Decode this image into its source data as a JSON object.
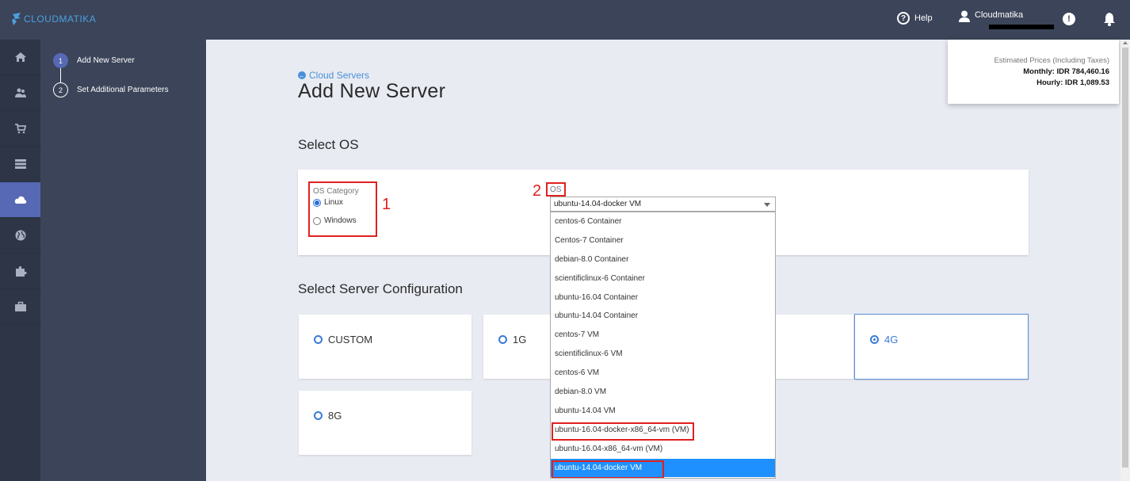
{
  "brand": {
    "logo_text": "CLOUDMATIKA",
    "accent": "#4da0df"
  },
  "topbar": {
    "help_label": "Help",
    "user_name": "Cloudmatika"
  },
  "iconbar": [
    "home-icon",
    "users-icon",
    "cart-icon",
    "server-list-icon",
    "cloud-icon",
    "globe-icon",
    "puzzle-icon",
    "briefcase-icon"
  ],
  "steps": [
    {
      "num": "1",
      "label": "Add New Server"
    },
    {
      "num": "2",
      "label": "Set Additional Parameters"
    }
  ],
  "main": {
    "back_label": "Cloud Servers",
    "title": "Add New Server",
    "select_os_heading": "Select OS",
    "config_heading": "Select Server Configuration"
  },
  "os_section": {
    "category_label": "OS Category",
    "linux_label": "Linux",
    "windows_label": "Windows",
    "os_label": "OS",
    "selected_os": "ubuntu-14.04-docker VM",
    "annotation_1": "1",
    "annotation_2": "2",
    "options": [
      "centos-6 Container",
      "Centos-7 Container",
      "debian-8.0 Container",
      "scientificlinux-6 Container",
      "ubuntu-16.04 Container",
      "ubuntu-14.04 Container",
      "centos-7 VM",
      "scientificlinux-6 VM",
      "centos-6 VM",
      "debian-8.0 VM",
      "ubuntu-14.04 VM",
      "ubuntu-16.04-docker-x86_64-vm (VM)",
      "ubuntu-16.04-x86_64-vm (VM)",
      "ubuntu-14.04-docker VM"
    ]
  },
  "configs": [
    {
      "name": "CUSTOM"
    },
    {
      "name": "1G"
    },
    {
      "name": "4G",
      "selected": true
    },
    {
      "name": "8G"
    }
  ],
  "prices": {
    "heading": "Estimated Prices (Including Taxes)",
    "monthly": "Monthly: IDR 784,460.16",
    "hourly": "Hourly: IDR 1,089.53"
  }
}
